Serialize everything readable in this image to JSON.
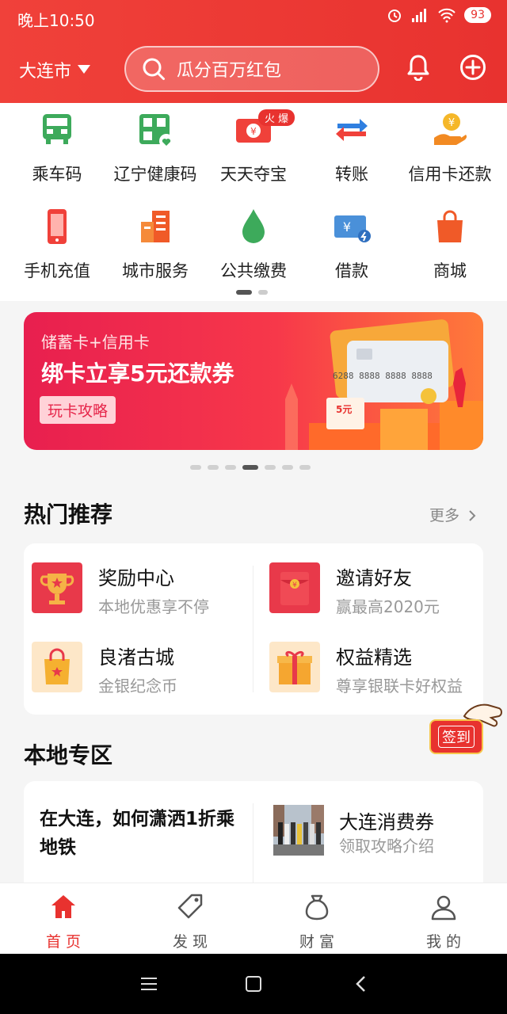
{
  "status": {
    "time": "晚上10:50",
    "battery": "93"
  },
  "header": {
    "city": "大连市",
    "search_placeholder": "瓜分百万红包"
  },
  "grid": [
    {
      "label": "乘车码",
      "icon": "bus-code-icon"
    },
    {
      "label": "辽宁健康码",
      "icon": "health-code-icon"
    },
    {
      "label": "天天夺宝",
      "icon": "treasure-icon",
      "badge": "火 爆"
    },
    {
      "label": "转账",
      "icon": "transfer-icon"
    },
    {
      "label": "信用卡还款",
      "icon": "credit-repay-icon"
    },
    {
      "label": "手机充值",
      "icon": "phone-topup-icon"
    },
    {
      "label": "城市服务",
      "icon": "city-service-icon"
    },
    {
      "label": "公共缴费",
      "icon": "utility-pay-icon"
    },
    {
      "label": "借款",
      "icon": "loan-icon"
    },
    {
      "label": "商城",
      "icon": "mall-icon"
    }
  ],
  "banner": {
    "line1": "储蓄卡+信用卡",
    "line2": "绑卡立享5元还款券",
    "button": "玩卡攻略",
    "card_number": "6288 8888 8888 8888",
    "coupon": "5元"
  },
  "hot": {
    "title": "热门推荐",
    "more": "更多",
    "items": [
      {
        "title": "奖励中心",
        "subtitle": "本地优惠享不停",
        "icon": "trophy-icon"
      },
      {
        "title": "邀请好友",
        "subtitle": "赢最高2020元",
        "icon": "red-envelope-icon"
      },
      {
        "title": "良渚古城",
        "subtitle": "金银纪念币",
        "icon": "shopping-bag-icon"
      },
      {
        "title": "权益精选",
        "subtitle": "尊享银联卡好权益",
        "icon": "gift-icon"
      }
    ]
  },
  "signin": {
    "label": "签到"
  },
  "local": {
    "title": "本地专区",
    "left_title": "在大连，如何潇洒1折乘地铁",
    "right_title": "大连消费券",
    "right_subtitle": "领取攻略介绍"
  },
  "tabs": [
    {
      "label": "首 页",
      "icon": "home-icon",
      "active": true
    },
    {
      "label": "发 现",
      "icon": "tag-icon",
      "active": false
    },
    {
      "label": "财 富",
      "icon": "money-bag-icon",
      "active": false
    },
    {
      "label": "我 的",
      "icon": "user-icon",
      "active": false
    }
  ],
  "colors": {
    "brand": "#e8322f",
    "active_tab": "#e8322f"
  }
}
